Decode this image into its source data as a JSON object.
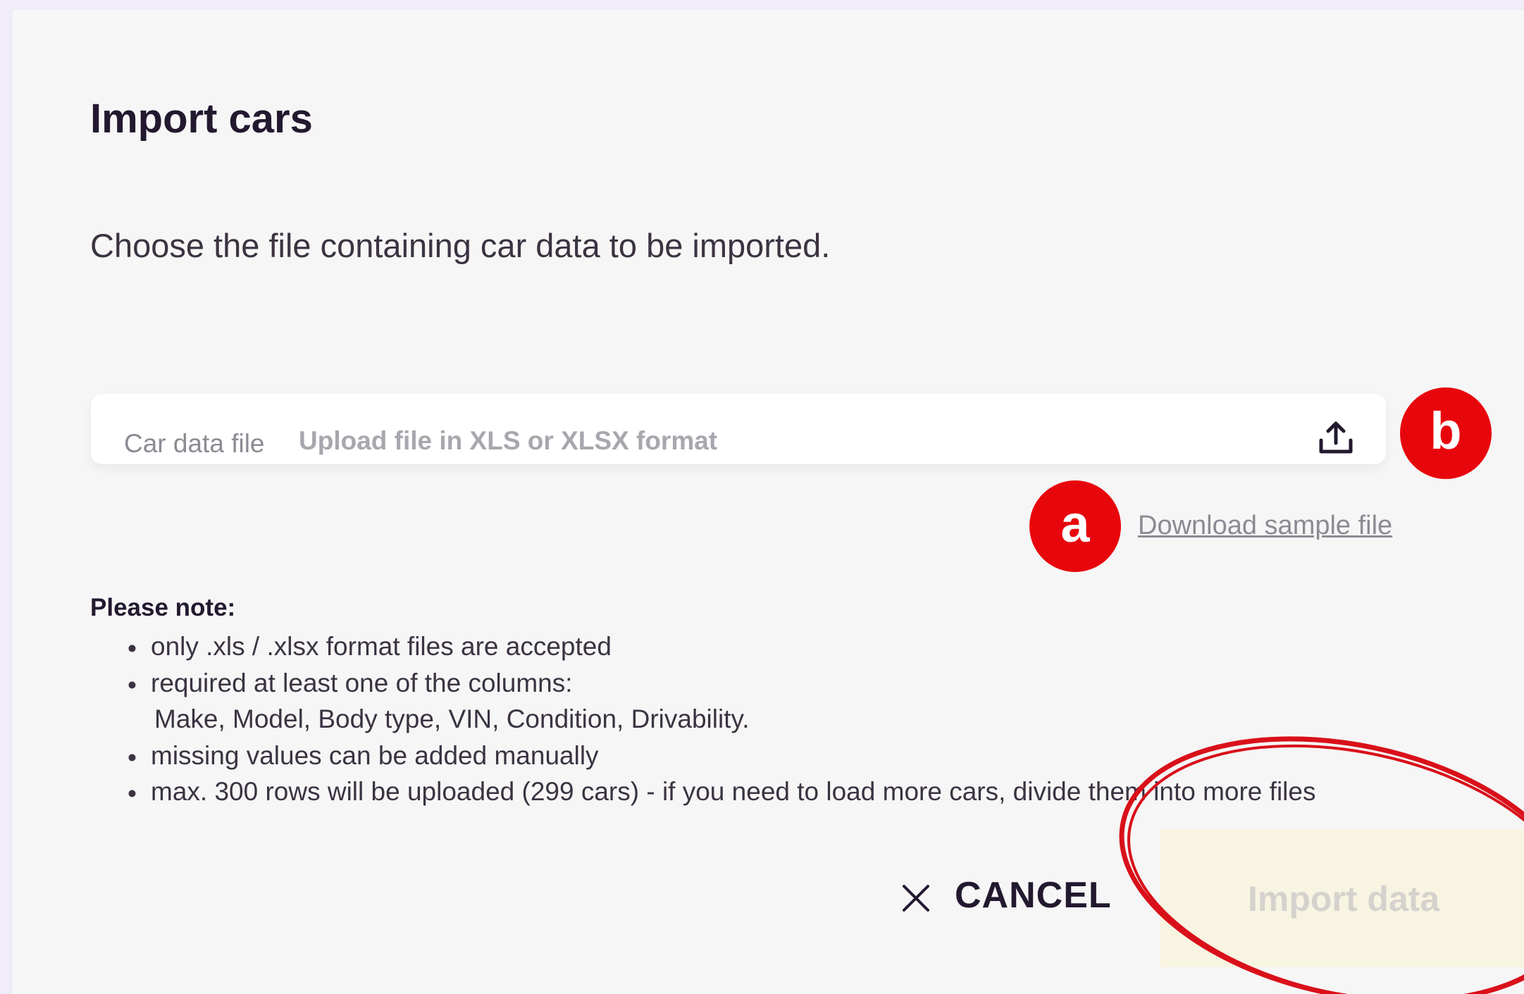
{
  "dialog": {
    "title": "Import cars",
    "subtitle": "Choose the file containing car data to be imported."
  },
  "upload": {
    "label": "Car data file",
    "placeholder": "Upload file in XLS or XLSX format",
    "icon": "upload-icon"
  },
  "annotations": {
    "badge_a": "a",
    "badge_b": "b",
    "badge_color": "#e8060d",
    "highlight_color": "#d9101a"
  },
  "download": {
    "label": "Download sample file"
  },
  "notes": {
    "title": "Please note:",
    "items": [
      "only .xls / .xlsx format files are accepted",
      "required at least one of the columns:",
      "missing values can be added manually",
      "max. 300 rows will be uploaded (299 cars) - if you need to load more cars, divide them into more files"
    ],
    "required_columns": "Make, Model, Body type, VIN, Condition, Drivability."
  },
  "actions": {
    "cancel_label": "CANCEL",
    "import_label": "Import data",
    "import_disabled": true
  }
}
